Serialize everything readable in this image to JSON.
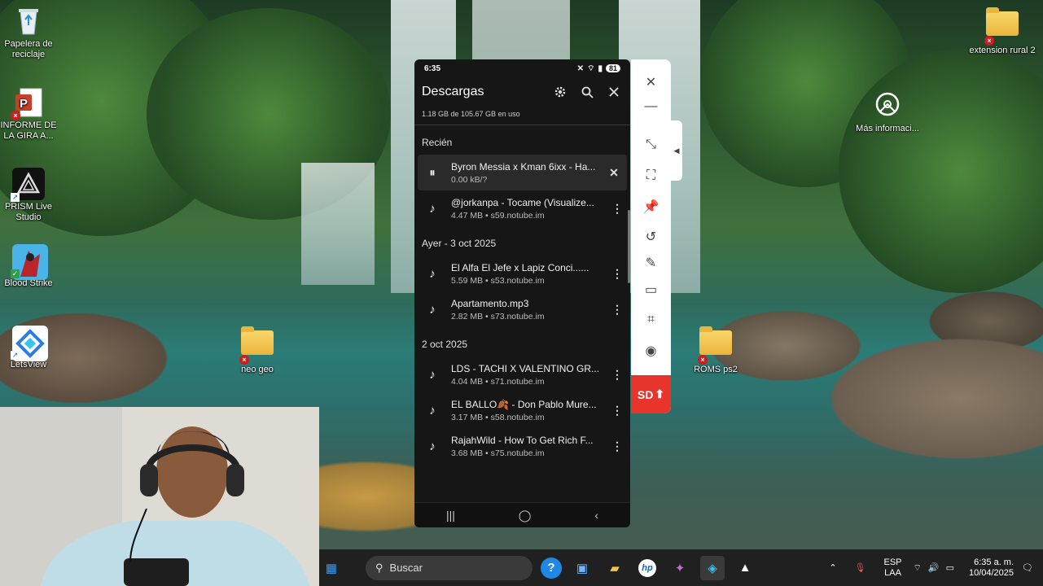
{
  "desktop": {
    "icons": [
      {
        "label": "Papelera de reciclaje",
        "icon": "recycle-bin-icon"
      },
      {
        "label": "INFORME DE LA GIRA A...",
        "icon": "powerpoint-file-icon"
      },
      {
        "label": "PRISM Live Studio",
        "icon": "prism-app-icon"
      },
      {
        "label": "Blood Strike",
        "icon": "game-icon"
      },
      {
        "label": "LetsView",
        "icon": "letsview-app-icon"
      },
      {
        "label": "neo geo",
        "icon": "folder-icon"
      },
      {
        "label": "ROMS ps2",
        "icon": "folder-icon"
      },
      {
        "label": "extension rural 2",
        "icon": "folder-icon"
      },
      {
        "label": "Más informaci...",
        "icon": "info-camera-icon"
      }
    ]
  },
  "phone": {
    "status": {
      "time": "6:35",
      "battery": "81"
    },
    "title": "Descargas",
    "usage": "1.18 GB de 105.67 GB en uso",
    "sections": [
      {
        "label": "Recién",
        "items": [
          {
            "name": "Byron Messia x Kman 6ixx - Ha...",
            "sub": "0.00 kB/?",
            "state": "paused"
          },
          {
            "name": "@jorkanpa - Tocame (Visualize...",
            "sub": "4.47 MB • s59.notube.im",
            "state": "done"
          }
        ]
      },
      {
        "label": "Ayer - 3 oct 2025",
        "items": [
          {
            "name": "El Alfa El Jefe x Lapiz Conci......",
            "sub": "5.59 MB • s53.notube.im",
            "state": "done"
          },
          {
            "name": "Apartamento.mp3",
            "sub": "2.82 MB • s73.notube.im",
            "state": "done"
          }
        ]
      },
      {
        "label": "2 oct 2025",
        "items": [
          {
            "name": "LDS - TACHI X VALENTINO GR...",
            "sub": "4.04 MB • s71.notube.im",
            "state": "done"
          },
          {
            "name": "EL BALLO🍂 - Don Pablo Mure...",
            "sub": "3.17 MB • s58.notube.im",
            "state": "done"
          },
          {
            "name": "RajahWild - How To Get Rich F...",
            "sub": "3.68 MB • s75.notube.im",
            "state": "done"
          }
        ]
      }
    ]
  },
  "toolbar": {
    "sd_label": "SD"
  },
  "taskbar": {
    "search_placeholder": "Buscar",
    "lang_top": "ESP",
    "lang_bottom": "LAA",
    "clock_time": "6:35 a. m.",
    "clock_date": "10/04/2025"
  },
  "colors": {
    "accent_red": "#e8352b",
    "panel_bg": "#161616",
    "taskbar_bg": "#202020"
  }
}
